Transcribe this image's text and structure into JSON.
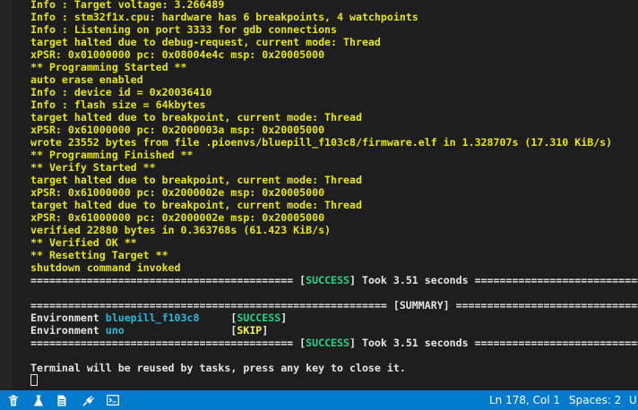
{
  "terminal": {
    "lines": [
      {
        "segs": [
          {
            "t": "Info : Target voltage: 3.266489",
            "c": "y"
          }
        ]
      },
      {
        "segs": [
          {
            "t": "Info : stm32f1x.cpu: hardware has 6 breakpoints, 4 watchpoints",
            "c": "y"
          }
        ]
      },
      {
        "segs": [
          {
            "t": "Info : Listening on port 3333 for gdb connections",
            "c": "y"
          }
        ]
      },
      {
        "segs": [
          {
            "t": "target halted due to debug-request, current mode: Thread",
            "c": "y"
          }
        ]
      },
      {
        "segs": [
          {
            "t": "xPSR: 0x01000000 pc: 0x08004e4c msp: 0x20005000",
            "c": "y"
          }
        ]
      },
      {
        "segs": [
          {
            "t": "** Programming Started **",
            "c": "y"
          }
        ]
      },
      {
        "segs": [
          {
            "t": "auto erase enabled",
            "c": "y"
          }
        ]
      },
      {
        "segs": [
          {
            "t": "Info : device id = 0x20036410",
            "c": "y"
          }
        ]
      },
      {
        "segs": [
          {
            "t": "Info : flash size = 64kbytes",
            "c": "y"
          }
        ]
      },
      {
        "segs": [
          {
            "t": "target halted due to breakpoint, current mode: Thread",
            "c": "y"
          }
        ]
      },
      {
        "segs": [
          {
            "t": "xPSR: 0x61000000 pc: 0x2000003a msp: 0x20005000",
            "c": "y"
          }
        ]
      },
      {
        "segs": [
          {
            "t": "wrote 23552 bytes from file .pioenvs/bluepill_f103c8/firmware.elf in 1.328707s (17.310 KiB/s)",
            "c": "y"
          }
        ]
      },
      {
        "segs": [
          {
            "t": "** Programming Finished **",
            "c": "y"
          }
        ]
      },
      {
        "segs": [
          {
            "t": "** Verify Started **",
            "c": "y"
          }
        ]
      },
      {
        "segs": [
          {
            "t": "target halted due to breakpoint, current mode: Thread",
            "c": "y"
          }
        ]
      },
      {
        "segs": [
          {
            "t": "xPSR: 0x61000000 pc: 0x2000002e msp: 0x20005000",
            "c": "y"
          }
        ]
      },
      {
        "segs": [
          {
            "t": "target halted due to breakpoint, current mode: Thread",
            "c": "y"
          }
        ]
      },
      {
        "segs": [
          {
            "t": "xPSR: 0x61000000 pc: 0x2000002e msp: 0x20005000",
            "c": "y"
          }
        ]
      },
      {
        "segs": [
          {
            "t": "verified 22880 bytes in 0.363768s (61.423 KiB/s)",
            "c": "y"
          }
        ]
      },
      {
        "segs": [
          {
            "t": "** Verified OK **",
            "c": "y"
          }
        ]
      },
      {
        "segs": [
          {
            "t": "** Resetting Target **",
            "c": "y"
          }
        ]
      },
      {
        "segs": [
          {
            "t": "shutdown command invoked",
            "c": "y"
          }
        ]
      },
      {
        "segs": [
          {
            "t": "========================================== [",
            "c": "w"
          },
          {
            "t": "SUCCESS",
            "c": "g"
          },
          {
            "t": "] Took 3.51 seconds ==========================================",
            "c": "w"
          }
        ]
      },
      {
        "segs": [
          {
            "t": "",
            "c": "w"
          }
        ]
      },
      {
        "segs": [
          {
            "t": "========================================================= [SUMMARY] =========================================================",
            "c": "w"
          }
        ]
      },
      {
        "segs": [
          {
            "t": "Environment ",
            "c": "w"
          },
          {
            "t": "bluepill_f103c8",
            "c": "b"
          },
          {
            "t": "     [",
            "c": "w"
          },
          {
            "t": "SUCCESS",
            "c": "g"
          },
          {
            "t": "]",
            "c": "w"
          }
        ]
      },
      {
        "segs": [
          {
            "t": "Environment ",
            "c": "w"
          },
          {
            "t": "uno",
            "c": "b"
          },
          {
            "t": "                 [",
            "c": "w"
          },
          {
            "t": "SKIP",
            "c": "ylw"
          },
          {
            "t": "]",
            "c": "w"
          }
        ]
      },
      {
        "segs": [
          {
            "t": "========================================== [",
            "c": "w"
          },
          {
            "t": "SUCCESS",
            "c": "g"
          },
          {
            "t": "] Took 3.51 seconds ==========================================",
            "c": "w"
          }
        ]
      },
      {
        "segs": [
          {
            "t": "",
            "c": "w"
          }
        ]
      },
      {
        "segs": [
          {
            "t": "Terminal will be reused by tasks, press any key to close it.",
            "c": "w"
          }
        ]
      }
    ]
  },
  "statusbar": {
    "icons": [
      "trash-icon",
      "flask-icon",
      "file-icon",
      "plug-icon",
      "terminal-icon"
    ],
    "position": "Ln 178, Col 1",
    "spaces": "Spaces: 2",
    "encoding_partial": "U"
  }
}
